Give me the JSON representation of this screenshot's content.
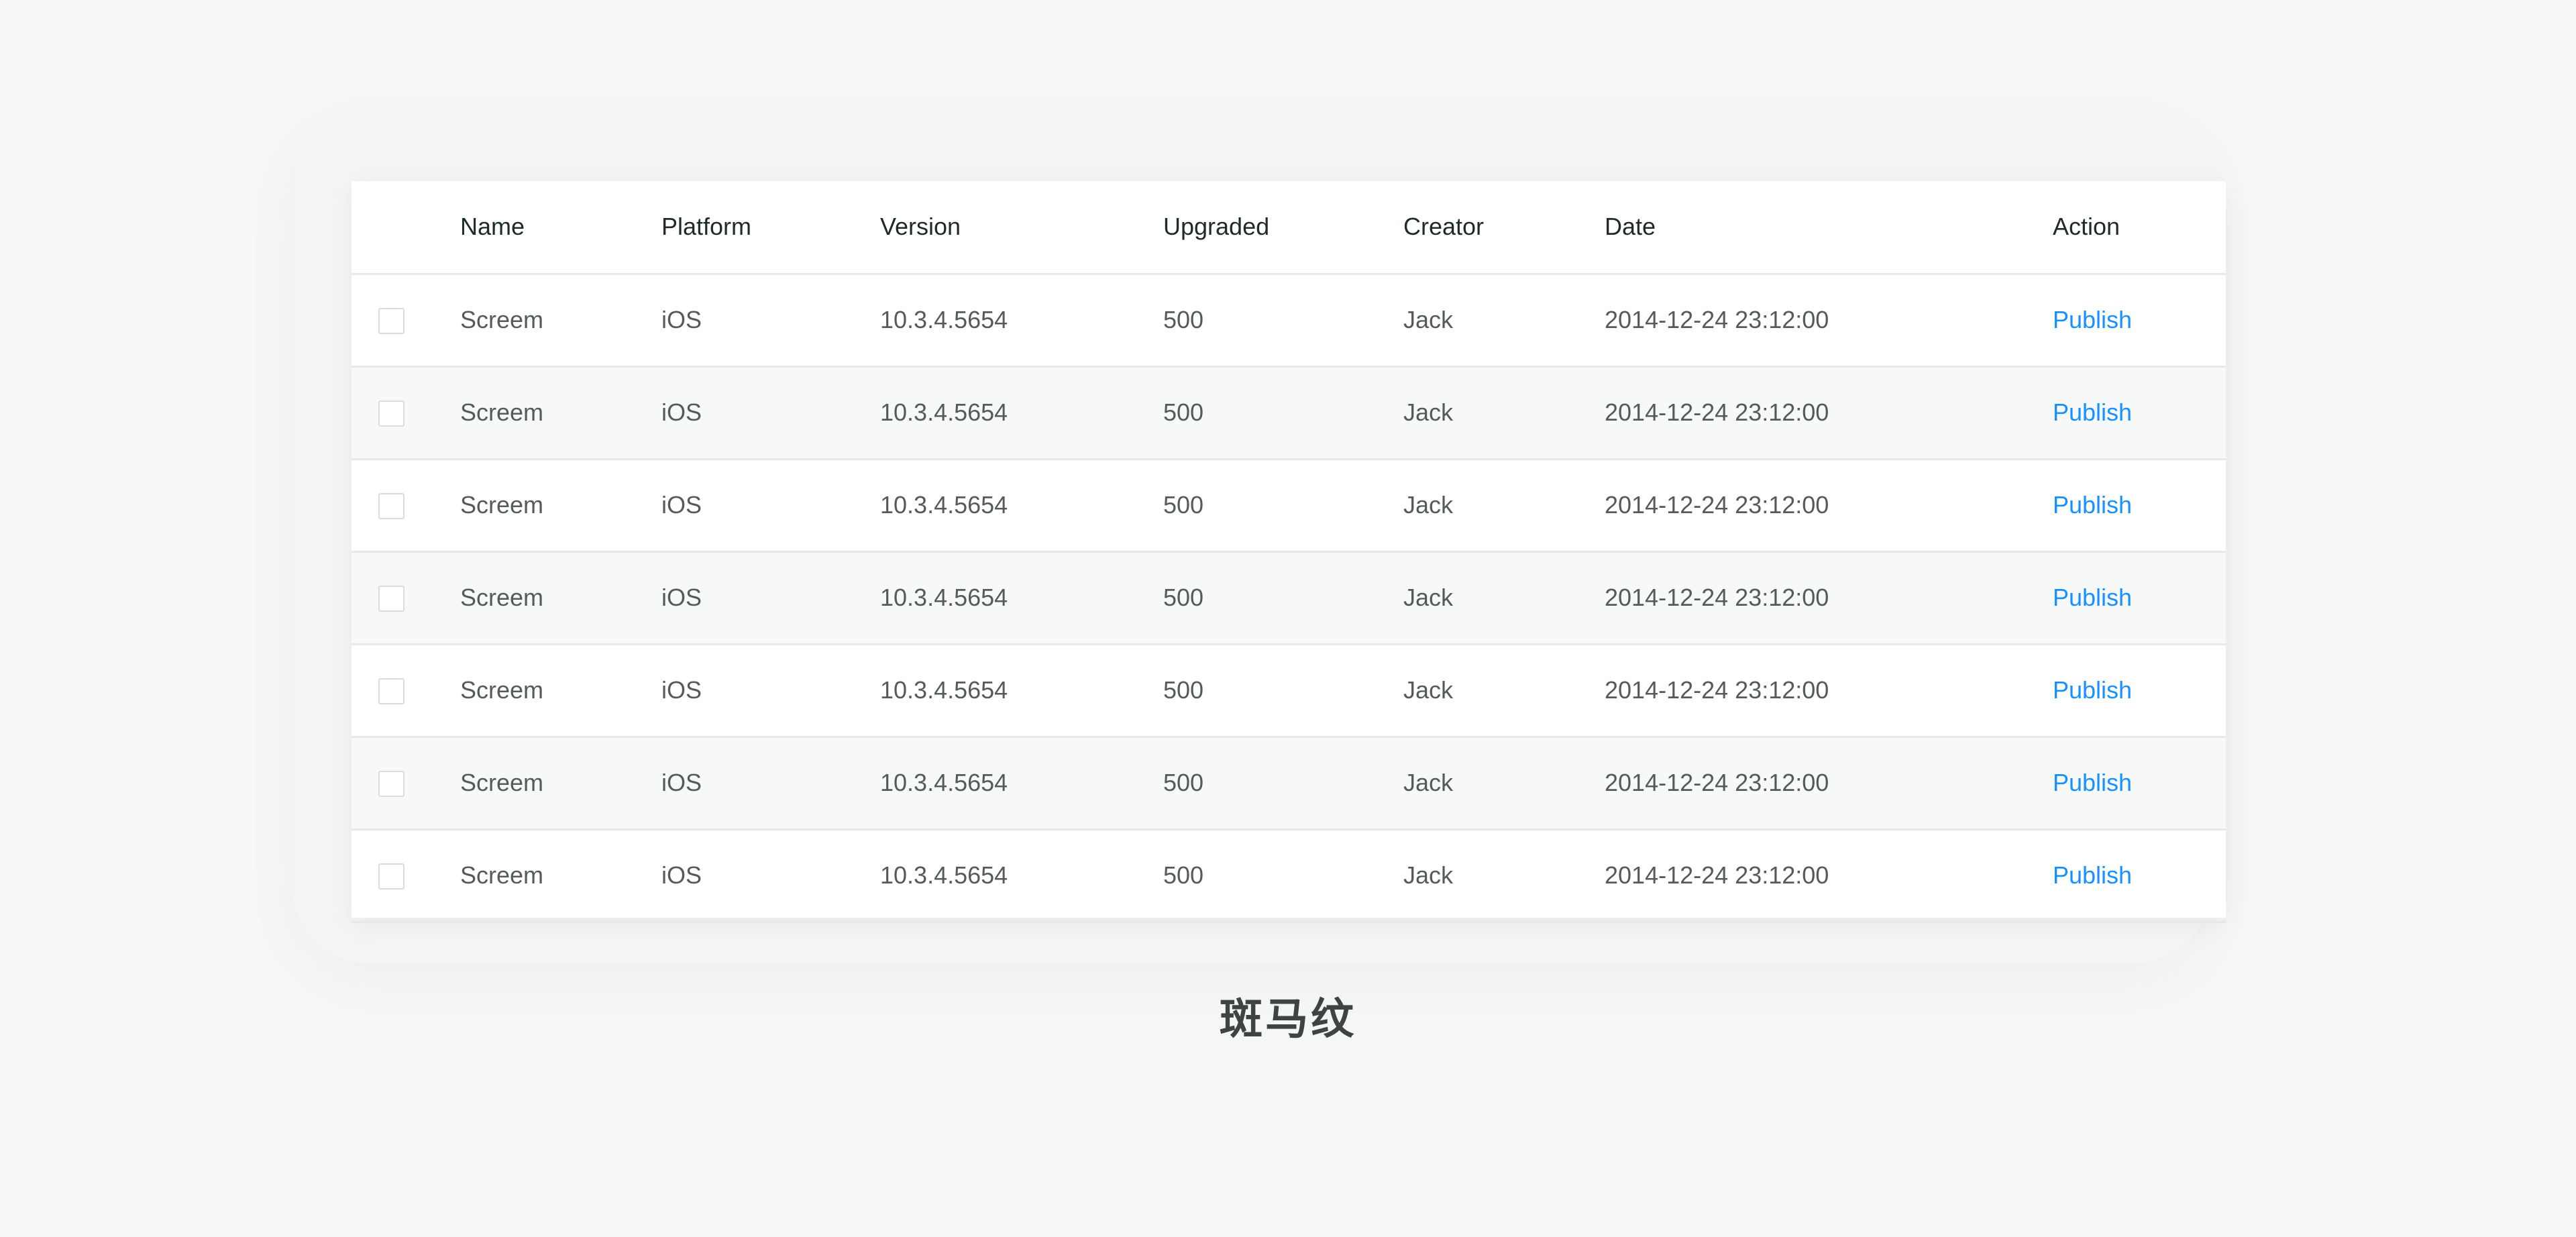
{
  "table": {
    "columns": [
      "Name",
      "Platform",
      "Version",
      "Upgraded",
      "Creator",
      "Date",
      "Action"
    ],
    "rows": [
      {
        "name": "Screem",
        "platform": "iOS",
        "version": "10.3.4.5654",
        "upgraded": "500",
        "creator": "Jack",
        "date": "2014-12-24 23:12:00",
        "action": "Publish"
      },
      {
        "name": "Screem",
        "platform": "iOS",
        "version": "10.3.4.5654",
        "upgraded": "500",
        "creator": "Jack",
        "date": "2014-12-24 23:12:00",
        "action": "Publish"
      },
      {
        "name": "Screem",
        "platform": "iOS",
        "version": "10.3.4.5654",
        "upgraded": "500",
        "creator": "Jack",
        "date": "2014-12-24 23:12:00",
        "action": "Publish"
      },
      {
        "name": "Screem",
        "platform": "iOS",
        "version": "10.3.4.5654",
        "upgraded": "500",
        "creator": "Jack",
        "date": "2014-12-24 23:12:00",
        "action": "Publish"
      },
      {
        "name": "Screem",
        "platform": "iOS",
        "version": "10.3.4.5654",
        "upgraded": "500",
        "creator": "Jack",
        "date": "2014-12-24 23:12:00",
        "action": "Publish"
      },
      {
        "name": "Screem",
        "platform": "iOS",
        "version": "10.3.4.5654",
        "upgraded": "500",
        "creator": "Jack",
        "date": "2014-12-24 23:12:00",
        "action": "Publish"
      },
      {
        "name": "Screem",
        "platform": "iOS",
        "version": "10.3.4.5654",
        "upgraded": "500",
        "creator": "Jack",
        "date": "2014-12-24 23:12:00",
        "action": "Publish"
      }
    ]
  },
  "caption": "斑马纹",
  "colors": {
    "accent": "#1890ff",
    "stripe": "#f7f9f9",
    "background": "#f5f6f6"
  }
}
